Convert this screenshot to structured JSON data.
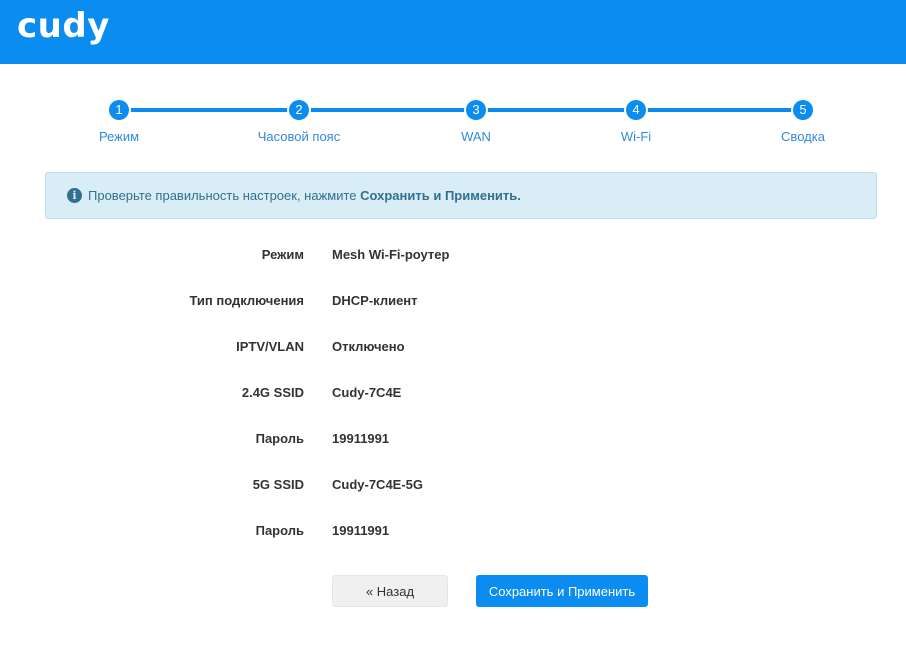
{
  "header": {
    "brand": "cudy"
  },
  "steps": [
    {
      "number": "1",
      "label": "Режим"
    },
    {
      "number": "2",
      "label": "Часовой пояс"
    },
    {
      "number": "3",
      "label": "WAN"
    },
    {
      "number": "4",
      "label": "Wi-Fi"
    },
    {
      "number": "5",
      "label": "Сводка"
    }
  ],
  "alert": {
    "icon": "info-icon",
    "text_prefix": "Проверьте правильность настроек, нажмите ",
    "text_bold": "Сохранить и Применить."
  },
  "summary": [
    {
      "label": "Режим",
      "value": "Mesh Wi-Fi-роутер"
    },
    {
      "label": "Тип подключения",
      "value": "DHCP-клиент"
    },
    {
      "label": "IPTV/VLAN",
      "value": "Отключено"
    },
    {
      "label": "2.4G SSID",
      "value": "Cudy-7C4E"
    },
    {
      "label": "Пароль",
      "value": "19911991"
    },
    {
      "label": "5G SSID",
      "value": "Cudy-7C4E-5G"
    },
    {
      "label": "Пароль",
      "value": "19911991"
    }
  ],
  "buttons": {
    "back_label": "« Назад",
    "save_label": "Сохранить и Применить"
  },
  "colors": {
    "brand": "#0a8cf0",
    "alert_bg": "#d9edf7",
    "alert_text": "#31708f"
  }
}
